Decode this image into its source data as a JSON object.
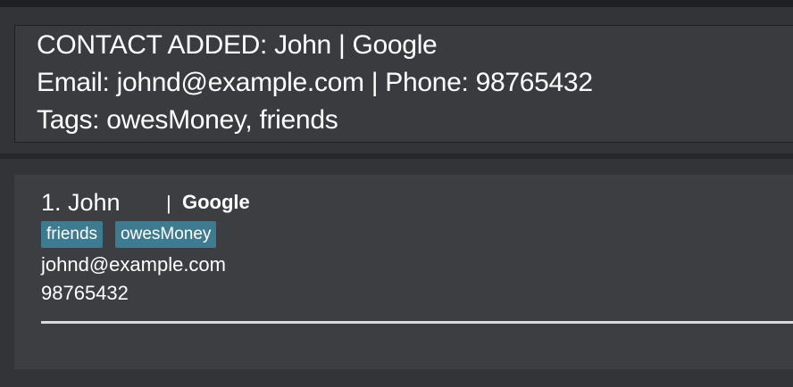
{
  "result_display": {
    "line1": "CONTACT ADDED: John | Google",
    "line2": "Email: johnd@example.com | Phone: 98765432",
    "line3": "Tags: owesMoney, friends"
  },
  "person_list": {
    "cards": [
      {
        "index_name": "1. John",
        "separator": "|",
        "company": "Google",
        "tags": [
          "friends",
          "owesMoney"
        ],
        "email": "johnd@example.com",
        "phone": "98765432"
      }
    ]
  },
  "colors": {
    "background": "#2b2c2f",
    "panel": "#3a3b3e",
    "tag": "#3e7b91",
    "text": "#ffffff"
  }
}
